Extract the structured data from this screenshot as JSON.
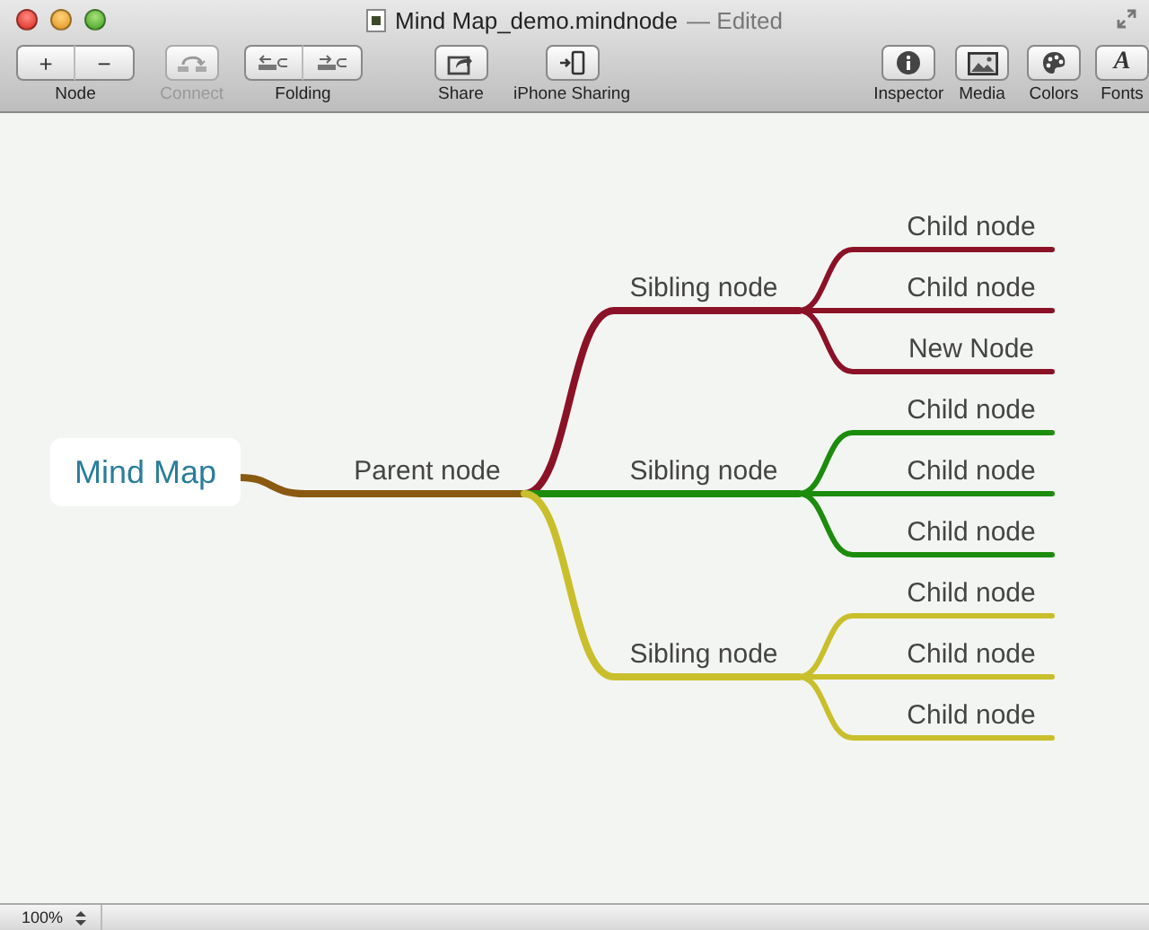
{
  "window": {
    "title": "Mind Map_demo.mindnode",
    "edited": "— Edited"
  },
  "toolbar": [
    {
      "kind": "node",
      "label": "Node",
      "disabled": false,
      "keys": [
        "+",
        "−"
      ]
    },
    {
      "kind": "connect",
      "label": "Connect",
      "disabled": true
    },
    {
      "kind": "folding",
      "label": "Folding",
      "disabled": false
    },
    {
      "kind": "share",
      "label": "Share",
      "disabled": false
    },
    {
      "kind": "iphone",
      "label": "iPhone Sharing",
      "disabled": false
    },
    {
      "kind": "inspector",
      "label": "Inspector",
      "disabled": false
    },
    {
      "kind": "media",
      "label": "Media",
      "disabled": false
    },
    {
      "kind": "colors",
      "label": "Colors",
      "disabled": false
    },
    {
      "kind": "fonts",
      "label": "Fonts",
      "disabled": false,
      "glyph": "A"
    }
  ],
  "map": {
    "root": {
      "text": "Mind Map",
      "children": [
        {
          "text": "Parent node",
          "color": "#8a5a12",
          "children": [
            {
              "text": "Sibling node",
              "color": "#8b1226",
              "children": [
                {
                  "text": "Child node"
                },
                {
                  "text": "Child node"
                },
                {
                  "text": "New Node"
                }
              ]
            },
            {
              "text": "Sibling node",
              "color": "#1c8c0c",
              "children": [
                {
                  "text": "Child node"
                },
                {
                  "text": "Child node"
                },
                {
                  "text": "Child node"
                }
              ]
            },
            {
              "text": "Sibling node",
              "color": "#c9bf2c",
              "children": [
                {
                  "text": "Child node"
                },
                {
                  "text": "Child node"
                },
                {
                  "text": "Child node"
                }
              ]
            }
          ]
        }
      ]
    }
  },
  "status_bar": {
    "zoom": "100%"
  }
}
